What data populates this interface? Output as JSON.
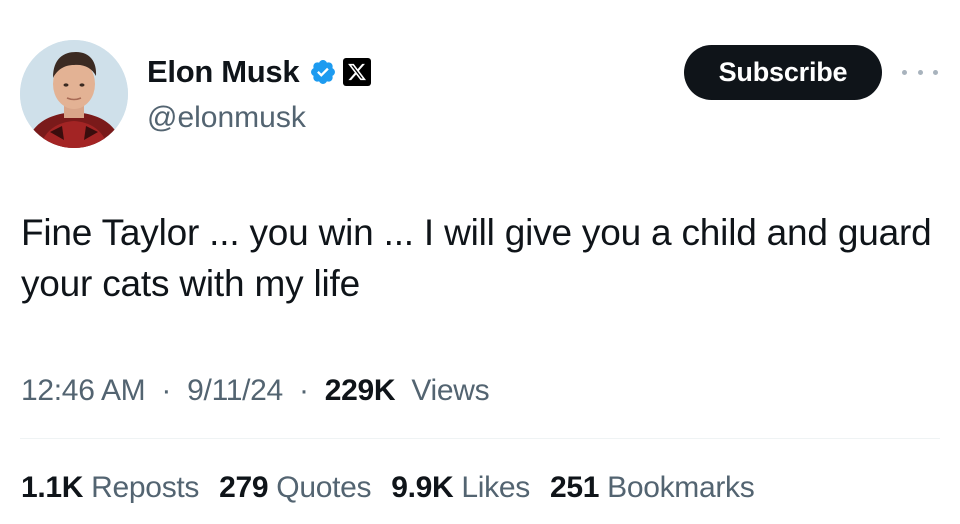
{
  "author": {
    "display_name": "Elon Musk",
    "handle": "@elonmusk",
    "verified_badge": "verified-check-icon",
    "affiliation_badge": "x-logo-icon"
  },
  "header": {
    "subscribe_label": "Subscribe",
    "more_icon": "more-dots-icon"
  },
  "tweet": {
    "text": "Fine Taylor ... you win ... I will give you a child and guard your cats with my life"
  },
  "meta": {
    "time": "12:46 AM",
    "date": "9/11/24",
    "views_count": "229K",
    "views_label": "Views",
    "separator": "·"
  },
  "stats": [
    {
      "count": "1.1K",
      "label": "Reposts"
    },
    {
      "count": "279",
      "label": "Quotes"
    },
    {
      "count": "9.9K",
      "label": "Likes"
    },
    {
      "count": "251",
      "label": "Bookmarks"
    }
  ],
  "colors": {
    "text_primary": "#0f1419",
    "text_secondary": "#536471",
    "verified_blue": "#1d9bf0",
    "divider": "#eff3f4"
  }
}
